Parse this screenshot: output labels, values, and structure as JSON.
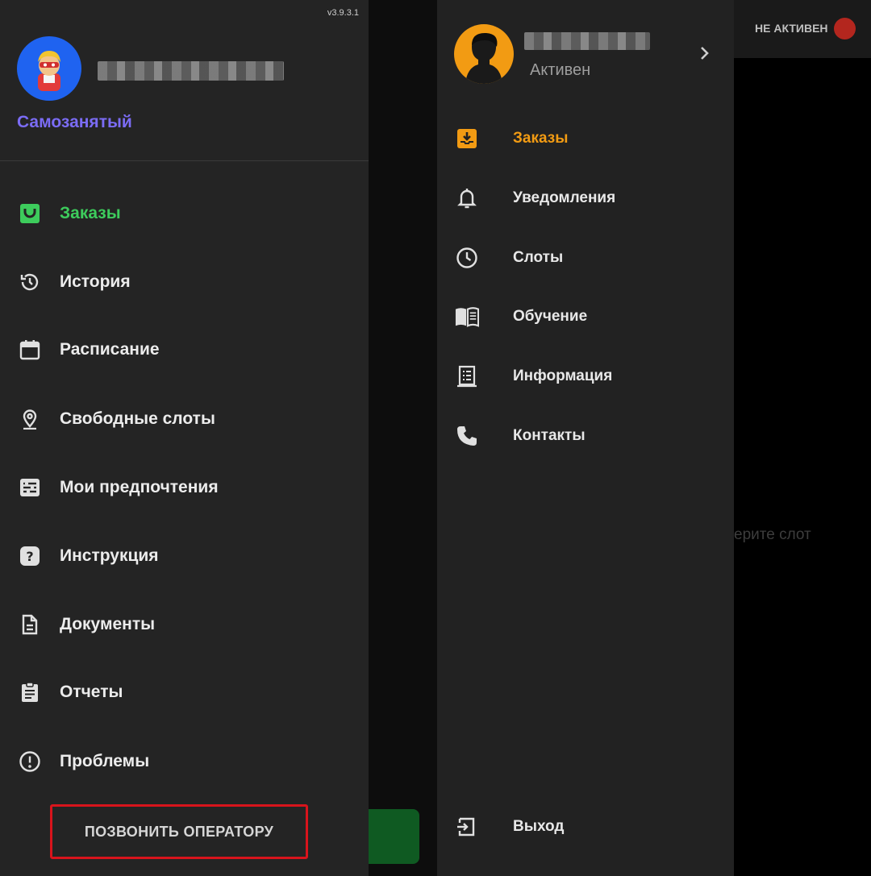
{
  "left_panel": {
    "version": "v3.9.3.1",
    "role": "Самозанятый",
    "menu": [
      {
        "label": "Заказы",
        "icon": "bag-icon",
        "active": true
      },
      {
        "label": "История",
        "icon": "history-icon"
      },
      {
        "label": "Расписание",
        "icon": "calendar-icon"
      },
      {
        "label": "Свободные слоты",
        "icon": "location-pin-icon"
      },
      {
        "label": "Мои предпочтения",
        "icon": "sliders-icon"
      },
      {
        "label": "Инструкция",
        "icon": "help-icon"
      },
      {
        "label": "Документы",
        "icon": "document-icon"
      },
      {
        "label": "Отчеты",
        "icon": "clipboard-icon"
      },
      {
        "label": "Проблемы",
        "icon": "alert-circle-icon"
      }
    ],
    "call_button": "ПОЗВОНИТЬ ОПЕРАТОРУ",
    "colors": {
      "active": "#3dcc5c",
      "role": "#7b6cf5",
      "highlight_border": "#d8141c"
    }
  },
  "right_panel": {
    "user_status": "Активен",
    "menu": [
      {
        "label": "Заказы",
        "icon": "inbox-download-icon",
        "active": true
      },
      {
        "label": "Уведомления",
        "icon": "bell-icon"
      },
      {
        "label": "Слоты",
        "icon": "clock-icon"
      },
      {
        "label": "Обучение",
        "icon": "book-icon"
      },
      {
        "label": "Информация",
        "icon": "info-list-icon"
      },
      {
        "label": "Контакты",
        "icon": "phone-icon"
      }
    ],
    "logout": {
      "label": "Выход",
      "icon": "logout-icon"
    },
    "colors": {
      "active": "#f29b13"
    }
  },
  "background": {
    "status_label": "НЕ АКТИВЕН",
    "hint_partial": "ерите слот"
  }
}
